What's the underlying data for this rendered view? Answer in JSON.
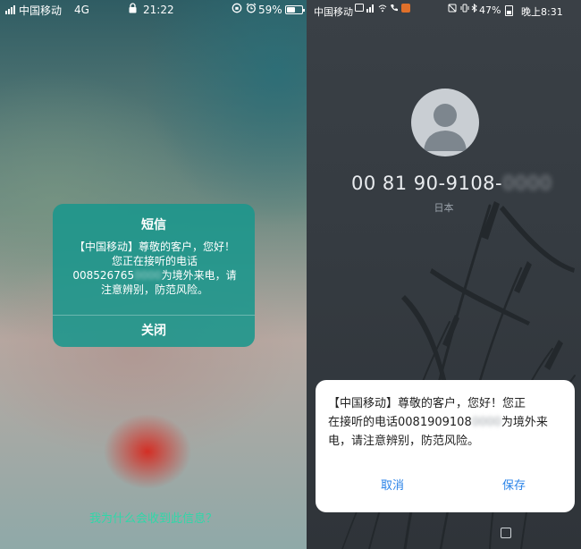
{
  "left_phone": {
    "status_bar": {
      "carrier": "中国移动",
      "network": "4G",
      "time": "21:22",
      "battery_percent": "59%",
      "battery_level": 0.59
    },
    "sms_dialog": {
      "title": "短信",
      "message_line1": "【中国移动】尊敬的客户，您好！",
      "message_line2": "您正在接听的电话",
      "number_visible": "008526765",
      "number_masked": "0000",
      "message_line3_suffix": "为境外来电，请",
      "message_line4": "注意辨别，防范风险。",
      "close_button": "关闭"
    },
    "why_link": "我为什么会收到此信息？"
  },
  "right_phone": {
    "status_bar": {
      "carrier": "中国移动",
      "battery_percent": "47%",
      "time": "晚上8:31",
      "battery_level": 0.47
    },
    "caller": {
      "number_visible": "00 81 90-9108-",
      "number_masked": "0000",
      "region": "日本"
    },
    "dialog": {
      "text_line1": "【中国移动】尊敬的客户，您好！您正",
      "text_line2_prefix": "在接听的电话0081909108",
      "text_line2_masked": "0000",
      "text_line2_suffix": "为境外来",
      "text_line3": "电，请注意辨别，防范风险。",
      "cancel_button": "取消",
      "save_button": "保存"
    }
  },
  "colors": {
    "sms_dialog_bg": "#1a968c",
    "why_link": "#2fd8a8",
    "dialog_button": "#2a83e8"
  },
  "icons": [
    "signal-bars-icon",
    "lock-icon",
    "rotation-lock-icon",
    "alarm-icon",
    "battery-icon",
    "wifi-icon",
    "phone-icon",
    "mute-icon",
    "bluetooth-icon",
    "person-avatar-icon",
    "recent-apps-icon"
  ]
}
